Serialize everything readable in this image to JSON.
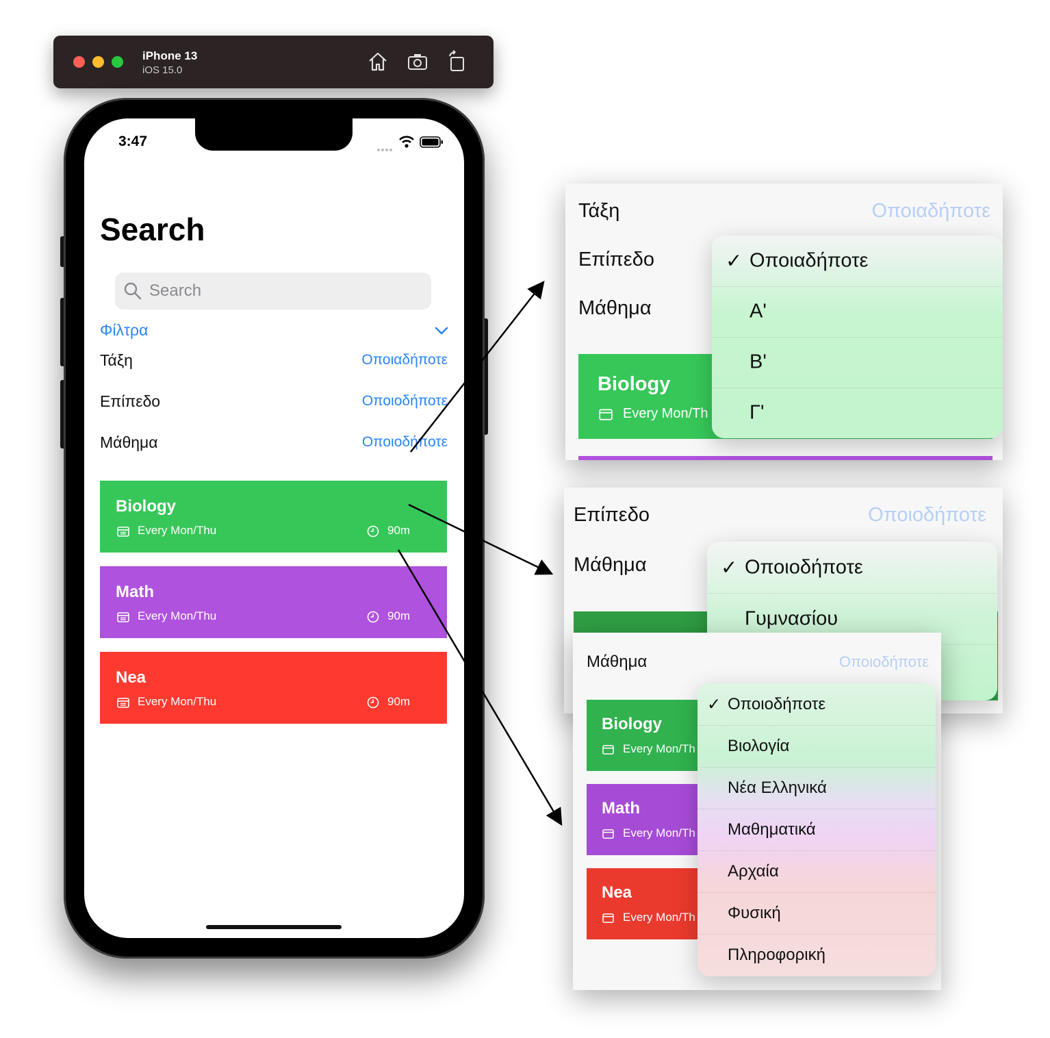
{
  "simulator": {
    "device": "iPhone 13",
    "os": "iOS 15.0",
    "traffic_light_colors": [
      "#fe5f57",
      "#febc2e",
      "#28c840"
    ],
    "icons": [
      "home-icon",
      "screenshot-icon",
      "rotate-icon"
    ]
  },
  "phone": {
    "time": "3:47",
    "title": "Search",
    "search_placeholder": "Search",
    "filters_label": "Φίλτρα",
    "filters": [
      {
        "label": "Τάξη",
        "value": "Οποιαδήποτε"
      },
      {
        "label": "Επίπεδο",
        "value": "Οποιοδήποτε"
      },
      {
        "label": "Μάθημα",
        "value": "Οποιοδήποτε"
      }
    ],
    "courses": [
      {
        "name": "Biology",
        "schedule": "Every Mon/Thu",
        "duration": "90m",
        "color": "#37c759"
      },
      {
        "name": "Math",
        "schedule": "Every Mon/Thu",
        "duration": "90m",
        "color": "#af52de"
      },
      {
        "name": "Nea",
        "schedule": "Every Mon/Thu",
        "duration": "90m",
        "color": "#fe3a30"
      }
    ]
  },
  "popup_taxi": {
    "rows": [
      {
        "label": "Τάξη",
        "value": "Οποιαδήποτε"
      },
      {
        "label": "Επίπεδο"
      },
      {
        "label": "Μάθημα"
      }
    ],
    "card": {
      "name": "Biology",
      "schedule": "Every Mon/Th"
    },
    "menu": [
      "Οποιαδήποτε",
      "Α'",
      "Β'",
      "Γ'"
    ],
    "selected_index": 0,
    "checkmark": "✓"
  },
  "popup_epipedo": {
    "rows": [
      {
        "label": "Επίπεδο",
        "value": "Οποιοδήποτε"
      },
      {
        "label": "Μάθημα"
      }
    ],
    "menu": [
      "Οποιοδήποτε",
      "Γυμνασίου"
    ],
    "selected_index": 0,
    "checkmark": "✓"
  },
  "popup_mathima": {
    "row": {
      "label": "Μάθημα",
      "value": "Οποιοδήποτε"
    },
    "cards": [
      {
        "name": "Biology",
        "schedule": "Every Mon/Th"
      },
      {
        "name": "Math",
        "schedule": "Every Mon/Th"
      },
      {
        "name": "Nea",
        "schedule": "Every Mon/Th"
      }
    ],
    "menu": [
      "Οποιοδήποτε",
      "Βιολογία",
      "Νέα Ελληνικά",
      "Μαθηματικά",
      "Αρχαία",
      "Φυσική",
      "Πληροφορική"
    ],
    "selected_index": 0,
    "checkmark": "✓"
  }
}
